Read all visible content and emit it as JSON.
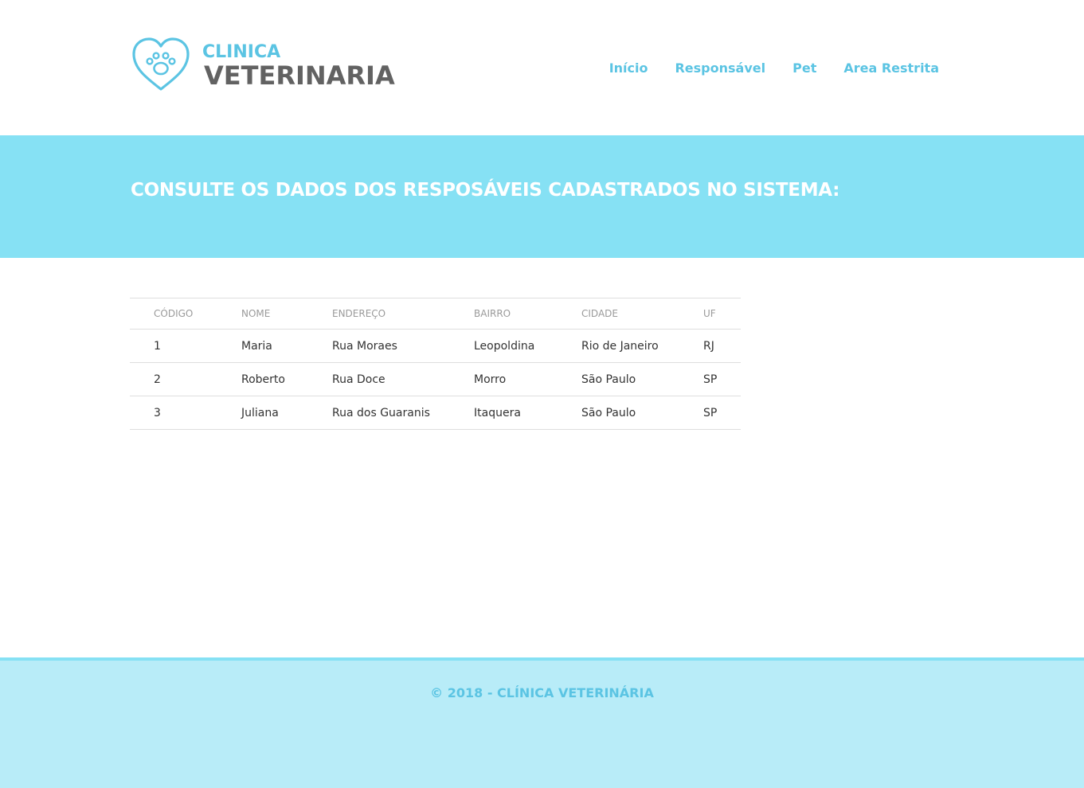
{
  "brand": {
    "line1": "CLINICA",
    "line2": "VETERINARIA",
    "accent_color": "#5bc4e3",
    "dark_color": "#626262"
  },
  "nav": {
    "items": [
      {
        "label": "Início"
      },
      {
        "label": "Responsável"
      },
      {
        "label": "Pet"
      },
      {
        "label": "Area Restrita"
      }
    ]
  },
  "hero": {
    "title": "CONSULTE OS DADOS DOS RESPOSÁVEIS CADASTRADOS NO SISTEMA:",
    "background": "#86e1f4"
  },
  "table": {
    "headers": [
      "CÓDIGO",
      "NOME",
      "ENDEREÇO",
      "BAIRRO",
      "CIDADE",
      "UF"
    ],
    "rows": [
      [
        "1",
        "Maria",
        "Rua Moraes",
        "Leopoldina",
        "Rio de Janeiro",
        "RJ"
      ],
      [
        "2",
        "Roberto",
        "Rua Doce",
        "Morro",
        "São Paulo",
        "SP"
      ],
      [
        "3",
        "Juliana",
        "Rua dos Guaranis",
        "Itaquera",
        "São Paulo",
        "SP"
      ]
    ]
  },
  "footer": {
    "text": "© 2018 - CLÍNICA VETERINÁRIA",
    "background": "#b8ecf8"
  },
  "icons": {
    "logo": "heart-paw-icon"
  }
}
